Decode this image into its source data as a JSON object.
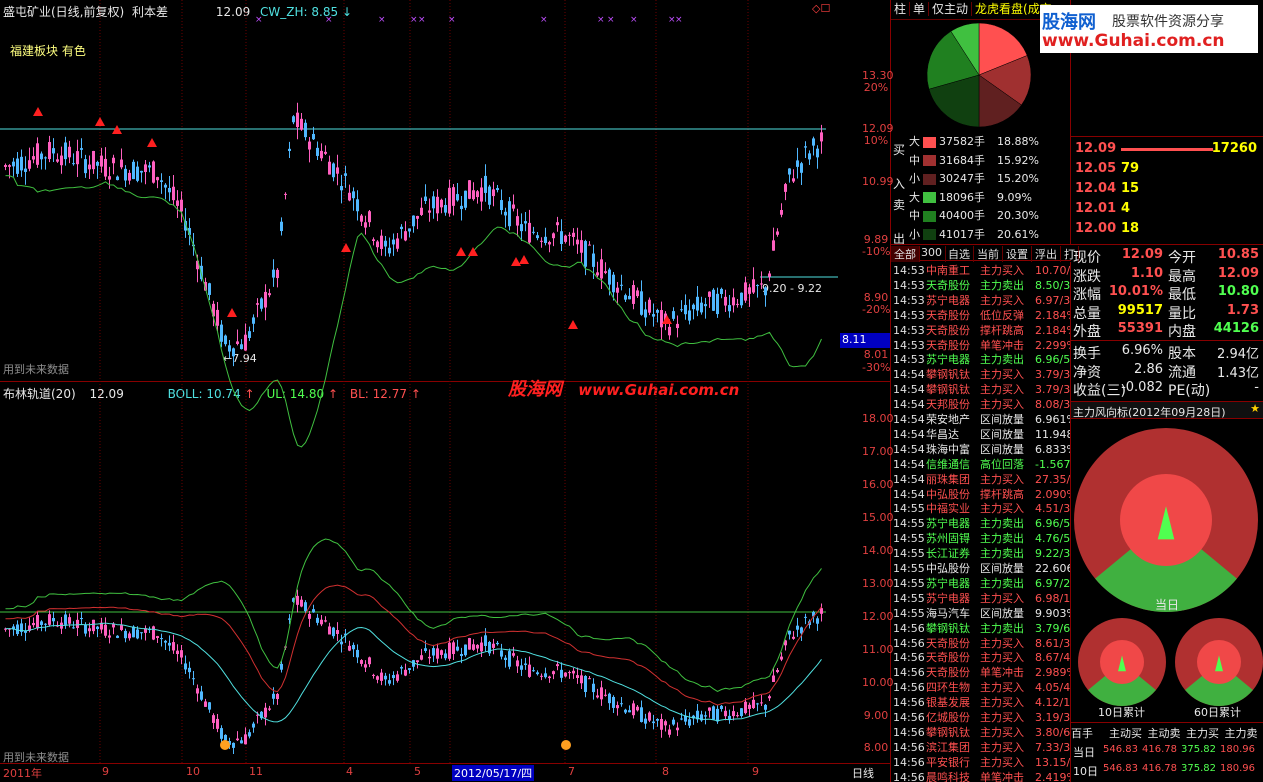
{
  "upper_chart": {
    "title": "盛屯矿业(日线,前复权)",
    "indicator_name": "利本差",
    "value": "12.09",
    "cw_label": "CW_ZH: 8.85",
    "sector_label": "福建板块 有色",
    "future_data_note": "用到未来数据",
    "low_label": "7.94",
    "range_label": "9.20 - 9.22",
    "price_tag": "8.11",
    "y_ticks": [
      "13.30",
      "12.09",
      "10.99",
      "9.89",
      "8.90",
      "8.01"
    ],
    "y_pcts": [
      "20%",
      "10%",
      "-10%",
      "-20%",
      "-30%"
    ]
  },
  "lower_chart": {
    "title": "布林轨道(20)",
    "value": "12.09",
    "boll_label": "BOLL: 10.74",
    "ul_label": "UL: 14.80",
    "bl_label": "BL: 12.77",
    "future_data_note": "用到未来数据",
    "y_ticks": [
      "18.00",
      "17.00",
      "16.00",
      "15.00",
      "14.00",
      "13.00",
      "12.00",
      "11.00",
      "10.00",
      "9.00",
      "8.00"
    ]
  },
  "watermark": {
    "cn": "股海网",
    "url": "www.Guhai.com.cn"
  },
  "x_axis": {
    "labels": [
      "2011年",
      "9",
      "10",
      "11",
      "4",
      "5",
      "2012/05/17/四",
      "7",
      "8",
      "9"
    ],
    "period_button": "日线"
  },
  "dragon_panel": {
    "tabs": [
      "柱",
      "单",
      "仅主动",
      "龙虎看盘(成交"
    ],
    "buy_label_1": "买",
    "buy_label_2": "入",
    "sell_label_1": "卖",
    "sell_label_2": "出",
    "rows": [
      {
        "size": "大",
        "vol": "37582手",
        "pct": "18.88%",
        "color": "#ff5050"
      },
      {
        "size": "中",
        "vol": "31684手",
        "pct": "15.92%",
        "color": "#a03030"
      },
      {
        "size": "小",
        "vol": "30247手",
        "pct": "15.20%",
        "color": "#602020"
      },
      {
        "size": "大",
        "vol": "18096手",
        "pct": "9.09%",
        "color": "#40c040"
      },
      {
        "size": "中",
        "vol": "40400手",
        "pct": "20.30%",
        "color": "#208020"
      },
      {
        "size": "小",
        "vol": "41017手",
        "pct": "20.61%",
        "color": "#104010"
      }
    ]
  },
  "stream_tabs": [
    "全部",
    "300",
    "自选",
    "当前",
    "设置",
    "浮出",
    "打"
  ],
  "stream": [
    {
      "t": "14:53",
      "name": "中南重工",
      "act": "主力买入",
      "v": "10.70/",
      "c": "red"
    },
    {
      "t": "14:53",
      "name": "天奇股份",
      "act": "主力卖出",
      "v": "8.50/3",
      "c": "green"
    },
    {
      "t": "14:53",
      "name": "苏宁电器",
      "act": "主力买入",
      "v": "6.97/3",
      "c": "red"
    },
    {
      "t": "14:53",
      "name": "天奇股份",
      "act": "低位反弹",
      "v": "2.184%",
      "c": "red"
    },
    {
      "t": "14:53",
      "name": "天奇股份",
      "act": "撑杆跳高",
      "v": "2.184%",
      "c": "red"
    },
    {
      "t": "14:53",
      "name": "天奇股份",
      "act": "单笔冲击",
      "v": "2.299%",
      "c": "red"
    },
    {
      "t": "14:53",
      "name": "苏宁电器",
      "act": "主力卖出",
      "v": "6.96/5",
      "c": "green"
    },
    {
      "t": "14:54",
      "name": "攀钢钒钛",
      "act": "主力买入",
      "v": "3.79/3",
      "c": "red"
    },
    {
      "t": "14:54",
      "name": "攀钢钒钛",
      "act": "主力买入",
      "v": "3.79/3",
      "c": "red"
    },
    {
      "t": "14:54",
      "name": "天邦股份",
      "act": "主力买入",
      "v": "8.08/3",
      "c": "red"
    },
    {
      "t": "14:54",
      "name": "荣安地产",
      "act": "区间放量",
      "v": "6.961%",
      "c": "white"
    },
    {
      "t": "14:54",
      "name": "华昌达",
      "act": "区间放量",
      "v": "11.948",
      "c": "white"
    },
    {
      "t": "14:54",
      "name": "珠海中富",
      "act": "区间放量",
      "v": "6.833%",
      "c": "white"
    },
    {
      "t": "14:54",
      "name": "信维通信",
      "act": "高位回落",
      "v": "-1.567",
      "c": "green"
    },
    {
      "t": "14:54",
      "name": "丽珠集团",
      "act": "主力买入",
      "v": "27.35/",
      "c": "red"
    },
    {
      "t": "14:54",
      "name": "中弘股份",
      "act": "撑杆跳高",
      "v": "2.090%",
      "c": "red"
    },
    {
      "t": "14:55",
      "name": "中福实业",
      "act": "主力买入",
      "v": "4.51/3",
      "c": "red"
    },
    {
      "t": "14:55",
      "name": "苏宁电器",
      "act": "主力卖出",
      "v": "6.96/5",
      "c": "green"
    },
    {
      "t": "14:55",
      "name": "苏州固锝",
      "act": "主力卖出",
      "v": "4.76/5",
      "c": "green"
    },
    {
      "t": "14:55",
      "name": "长江证券",
      "act": "主力卖出",
      "v": "9.22/3",
      "c": "green"
    },
    {
      "t": "14:55",
      "name": "中弘股份",
      "act": "区间放量",
      "v": "22.606",
      "c": "white"
    },
    {
      "t": "14:55",
      "name": "苏宁电器",
      "act": "主力卖出",
      "v": "6.97/2",
      "c": "green"
    },
    {
      "t": "14:55",
      "name": "苏宁电器",
      "act": "主力买入",
      "v": "6.98/1",
      "c": "red"
    },
    {
      "t": "14:55",
      "name": "海马汽车",
      "act": "区间放量",
      "v": "9.903%",
      "c": "white"
    },
    {
      "t": "14:56",
      "name": "攀钢钒钛",
      "act": "主力卖出",
      "v": "3.79/6",
      "c": "green"
    },
    {
      "t": "14:56",
      "name": "天奇股份",
      "act": "主力买入",
      "v": "8.61/3",
      "c": "red"
    },
    {
      "t": "14:56",
      "name": "天奇股份",
      "act": "主力买入",
      "v": "8.67/4",
      "c": "red"
    },
    {
      "t": "14:56",
      "name": "天奇股份",
      "act": "单笔冲击",
      "v": "2.989%",
      "c": "red"
    },
    {
      "t": "14:56",
      "name": "四环生物",
      "act": "主力买入",
      "v": "4.05/4",
      "c": "red"
    },
    {
      "t": "14:56",
      "name": "银基发展",
      "act": "主力买入",
      "v": "4.12/1",
      "c": "red"
    },
    {
      "t": "14:56",
      "name": "亿城股份",
      "act": "主力买入",
      "v": "3.19/3",
      "c": "red"
    },
    {
      "t": "14:56",
      "name": "攀钢钒钛",
      "act": "主力买入",
      "v": "3.80/6",
      "c": "red"
    },
    {
      "t": "14:56",
      "name": "滨江集团",
      "act": "主力买入",
      "v": "7.33/3",
      "c": "red"
    },
    {
      "t": "14:56",
      "name": "平安银行",
      "act": "主力买入",
      "v": "13.15/",
      "c": "red"
    },
    {
      "t": "14:56",
      "name": "晨鸣科技",
      "act": "单笔冲击",
      "v": "2.419%",
      "c": "red"
    }
  ],
  "logo": {
    "name": "股海网",
    "slogan": "股票软件资源分享",
    "url": "www.Guhai.com.cn"
  },
  "order_book": [
    {
      "price": "12.09",
      "vol": "17260"
    },
    {
      "price": "12.05",
      "vol": "79"
    },
    {
      "price": "12.04",
      "vol": "15"
    },
    {
      "price": "12.01",
      "vol": "4"
    },
    {
      "price": "12.00",
      "vol": "18"
    }
  ],
  "quote": [
    {
      "l1": "现价",
      "v1": "12.09",
      "l2": "今开",
      "v2": "10.85",
      "c1": "red",
      "c2": "red"
    },
    {
      "l1": "涨跌",
      "v1": "1.10",
      "l2": "最高",
      "v2": "12.09",
      "c1": "red",
      "c2": "red"
    },
    {
      "l1": "涨幅",
      "v1": "10.01%",
      "l2": "最低",
      "v2": "10.80",
      "c1": "red",
      "c2": "green"
    },
    {
      "l1": "总量",
      "v1": "99517",
      "l2": "量比",
      "v2": "1.73",
      "c1": "yellow",
      "c2": "red"
    },
    {
      "l1": "外盘",
      "v1": "55391",
      "l2": "内盘",
      "v2": "44126",
      "c1": "red",
      "c2": "green"
    }
  ],
  "fundamentals": [
    {
      "l1": "换手",
      "v1": "6.96%",
      "l2": "股本",
      "v2": "2.94亿"
    },
    {
      "l1": "净资",
      "v1": "2.86",
      "l2": "流通",
      "v2": "1.43亿"
    },
    {
      "l1": "收益(三)",
      "v1": "-0.082",
      "l2": "PE(动)",
      "v2": "-"
    }
  ],
  "wind_vane": {
    "title": "主力风向标",
    "date": "(2012年09月28日)",
    "gauge_main": "当日",
    "gauge_10": "10日累计",
    "gauge_60": "60日累计",
    "table_headers": [
      "百手",
      "主动买",
      "主动卖",
      "主力买",
      "主力卖"
    ],
    "table_rows": [
      {
        "label": "当日",
        "vals": [
          "546.83",
          "416.78",
          "375.82",
          "180.96"
        ]
      },
      {
        "label": "10日",
        "vals": [
          "546.83",
          "416.78",
          "375.82",
          "180.96"
        ]
      }
    ]
  },
  "colors": {
    "up": "#ff5050",
    "down": "#50b8ff",
    "grid": "#6b0000",
    "upper_band": "#40c040",
    "mid_band": "#d03030",
    "lower_band": "#50e0e0"
  }
}
